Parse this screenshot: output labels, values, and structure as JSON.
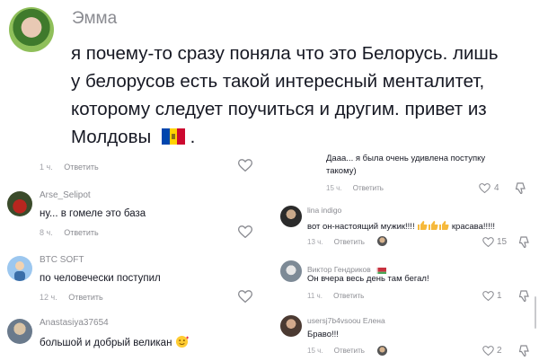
{
  "main_comment": {
    "username": "Эмма",
    "lines": [
      "я почему-то сразу поняла что это Белорусь. лишь",
      "у белорусов есть такой интересный менталитет,",
      "которому следует поучиться и другим. привет из",
      "Молдовы"
    ],
    "time": "1 ч.",
    "reply_label": "Ответить"
  },
  "left_comments": [
    {
      "username": "Arse_Selipot",
      "text": "ну... в гомеле это база",
      "time": "8 ч.",
      "reply_label": "Ответить"
    },
    {
      "username": "BTC SOFT",
      "text": "по человечески поступил",
      "time": "12 ч.",
      "reply_label": "Ответить"
    },
    {
      "username": "Anastasiya37654",
      "text": "большой и добрый великан",
      "time": "",
      "reply_label": ""
    }
  ],
  "right_comments": [
    {
      "username": "",
      "text_lines": [
        "Дааа... я была очень удивлена поступку",
        "такому)"
      ],
      "time": "15 ч.",
      "reply_label": "Ответить",
      "likes": "4"
    },
    {
      "username": "lina indigo",
      "text_lines": [
        "вот он-настоящий мужик!!!!",
        "красава!!!!!"
      ],
      "time": "13 ч.",
      "reply_label": "Ответить",
      "likes": "15"
    },
    {
      "username": "Виктор Гендриков",
      "text_lines": [
        "Он вчера весь день там бегал!"
      ],
      "time": "11 ч.",
      "reply_label": "Ответить",
      "likes": "1"
    },
    {
      "username": "usersj7b4vsoou Елена",
      "text_lines": [
        "Браво!!!"
      ],
      "time": "15 ч.",
      "reply_label": "Ответить",
      "likes": "2"
    }
  ],
  "colors": {
    "moldova_blue": "#0046ae",
    "moldova_yellow": "#ffd200",
    "moldova_red": "#cc092f",
    "belarus_red": "#c8313e",
    "belarus_green": "#4aa657"
  },
  "icons": [
    "heart-icon",
    "thumbs-down-icon",
    "reply-arrow-icon",
    "moldova-flag-icon",
    "belarus-flag-icon",
    "thumbs-up-emoji",
    "smiling-face-with-hearts-emoji"
  ]
}
